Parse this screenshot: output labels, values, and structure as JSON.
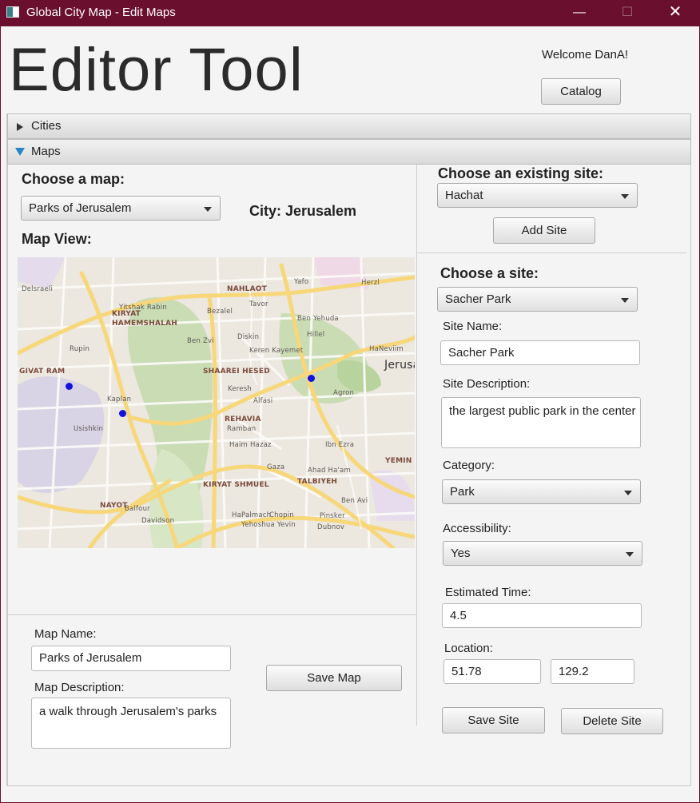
{
  "window": {
    "title": "Global City Map - Edit Maps",
    "min": "—",
    "max": "☐",
    "close": "✕"
  },
  "header": {
    "app_title": "Editor Tool",
    "welcome": "Welcome DanA!",
    "catalog_label": "Catalog"
  },
  "accordion": {
    "cities_label": "Cities",
    "maps_label": "Maps"
  },
  "map_section": {
    "choose_map_label": "Choose a map:",
    "selected_map": "Parks of Jerusalem",
    "city_label": "City: Jerusalem",
    "map_view_label": "Map View:",
    "map_labels": [
      "NAHLAOT",
      "KIRYAT",
      "HAMEMSHALAH",
      "GIVAT RAM",
      "SHAAREI HESED",
      "REHAVIA",
      "Ramban",
      "KIRYAT SHMUEL",
      "TALBIYEH",
      "NAYOT",
      "YEMIN M",
      "Jerusa",
      "Agron",
      "Dubnov",
      "Chopin",
      "Pinsker",
      "Bezalel",
      "Ben Yehuda",
      "Hillel",
      "Rupin",
      "Kaplan",
      "Yitshak Rabin",
      "Tavor",
      "Yafo",
      "Ben Zvi",
      "Keren Kayemet",
      "Gaza",
      "Haim Hazaz",
      "Alfasi",
      "Ibn Ezra",
      "Ahad Ha'am",
      "Balfour",
      "Davidson",
      "Yehoshua Yevin",
      "HaPalmach",
      "Ben Avi",
      "Delsraeli",
      "Herzl",
      "HaNeviim",
      "Keresh",
      "Diskin",
      "Usishkin"
    ],
    "map_name_label": "Map Name:",
    "map_name_value": "Parks of Jerusalem",
    "map_description_label": "Map Description:",
    "map_description_value": "a walk through Jerusalem's parks",
    "save_map_label": "Save Map"
  },
  "existing_site": {
    "label": "Choose an existing site:",
    "selected": "Hachat",
    "add_site_label": "Add Site"
  },
  "site_form": {
    "choose_site_label": "Choose a site:",
    "selected_site": "Sacher Park",
    "site_name_label": "Site Name:",
    "site_name_value": "Sacher Park",
    "site_description_label": "Site Description:",
    "site_description_value": "the largest public park in the center",
    "category_label": "Category:",
    "category_value": "Park",
    "accessibility_label": "Accessibility:",
    "accessibility_value": "Yes",
    "estimated_time_label": "Estimated Time:",
    "estimated_time_value": "4.5",
    "location_label": "Location:",
    "location_x": "51.78",
    "location_y": "129.2",
    "save_site_label": "Save Site",
    "delete_site_label": "Delete Site"
  },
  "colors": {
    "titlebar": "#6b0f2e",
    "map_dot": "#1212e0",
    "accordion_arrow": "#2a85c7"
  }
}
